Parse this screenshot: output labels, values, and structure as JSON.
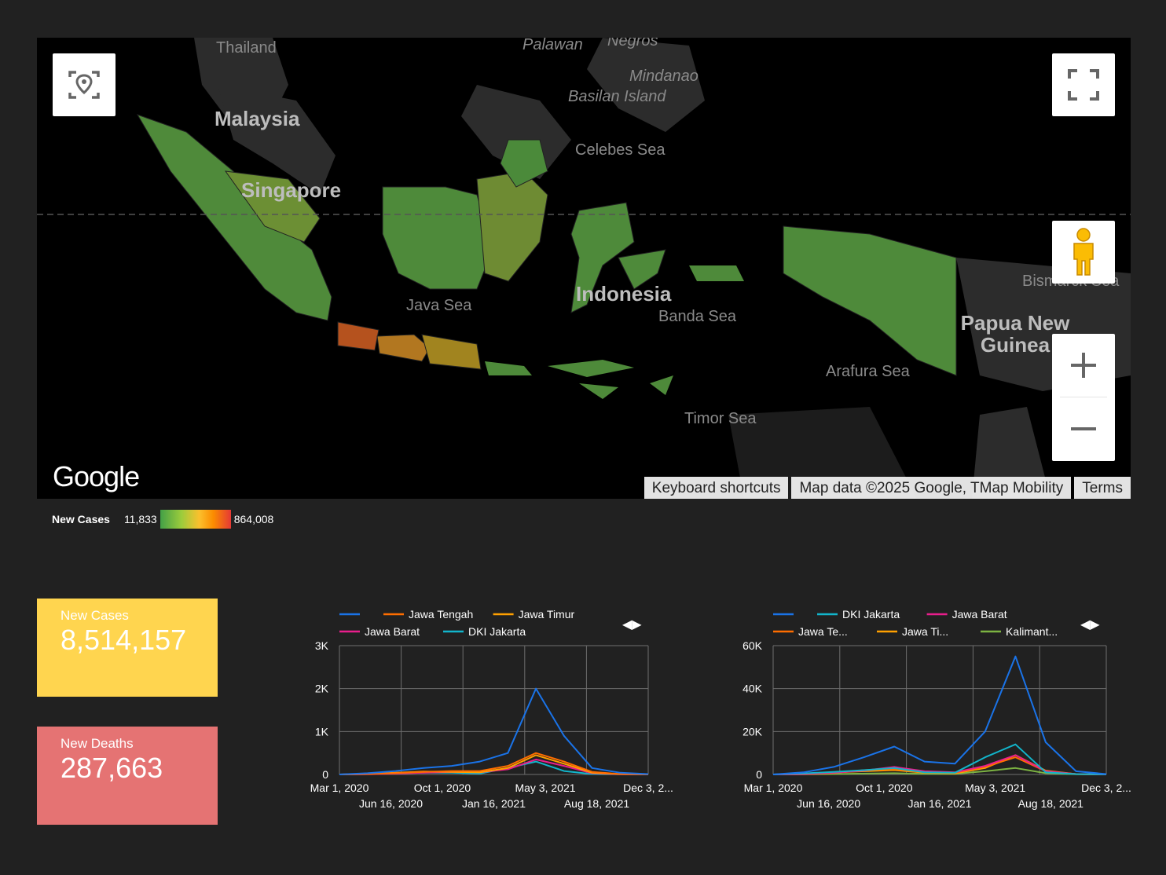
{
  "map": {
    "labels": {
      "thailand": "Thailand",
      "palawan": "Palawan",
      "negros": "Negros",
      "mindanao": "Mindanao",
      "basilan": "Basilan Island",
      "malaysia": "Malaysia",
      "celebes_sea": "Celebes Sea",
      "singapore": "Singapore",
      "bismarck_sea": "Bismarck Sea",
      "java_sea": "Java Sea",
      "indonesia": "Indonesia",
      "banda_sea": "Banda Sea",
      "papua": "Papua New Guinea",
      "arafura_sea": "Arafura Sea",
      "timor_sea": "Timor Sea"
    },
    "logo": "Google",
    "attribution": {
      "shortcuts": "Keyboard shortcuts",
      "map_data": "Map data ©2025 Google, TMap Mobility",
      "terms": "Terms"
    },
    "icons": {
      "locate": "location-focus-icon",
      "fullscreen": "fullscreen-icon",
      "pegman": "street-view-pegman-icon",
      "zoom_in": "plus-icon",
      "zoom_out": "minus-icon"
    }
  },
  "legend": {
    "title": "New Cases",
    "min": "11,833",
    "max": "864,008",
    "colors": [
      "#43a047",
      "#9ccc3c",
      "#fbc02d",
      "#fb8c00",
      "#e53935"
    ]
  },
  "scorecards": {
    "cases": {
      "label": "New Cases",
      "value": "8,514,157",
      "color": "#ffd54f"
    },
    "deaths": {
      "label": "New Deaths",
      "value": "287,663",
      "color": "#e57373"
    }
  },
  "chart_data": [
    {
      "type": "line",
      "legend_rows": [
        [
          {
            "name": "",
            "color": "#1a73e8"
          },
          {
            "name": "Jawa Tengah",
            "color": "#ff6d00"
          },
          {
            "name": "Jawa Timur",
            "color": "#ffa000"
          }
        ],
        [
          {
            "name": "Jawa Barat",
            "color": "#e91e8c"
          },
          {
            "name": "DKI Jakarta",
            "color": "#12b5cb"
          }
        ]
      ],
      "ylim": [
        0,
        3000
      ],
      "yticks": [
        "0",
        "1K",
        "2K",
        "3K"
      ],
      "xticks_row1": [
        "Mar 1, 2020",
        "Oct 1, 2020",
        "May 3, 2021",
        "Dec 3, 2..."
      ],
      "xticks_row2": [
        "Jun 16, 2020",
        "Jan 16, 2021",
        "Aug 18, 2021"
      ],
      "x": [
        "2020-03",
        "2020-06",
        "2020-09",
        "2020-12",
        "2021-03",
        "2021-05",
        "2021-06",
        "2021-07",
        "2021-08",
        "2021-09",
        "2021-10",
        "2021-12"
      ],
      "series": [
        {
          "name": "",
          "color": "#1a73e8",
          "values": [
            0,
            30,
            80,
            150,
            200,
            300,
            500,
            2000,
            900,
            150,
            40,
            10
          ]
        },
        {
          "name": "Jawa Tengah",
          "color": "#ff6d00",
          "values": [
            0,
            10,
            30,
            60,
            80,
            80,
            200,
            500,
            300,
            60,
            10,
            5
          ]
        },
        {
          "name": "Jawa Timur",
          "color": "#ffa000",
          "values": [
            0,
            15,
            40,
            70,
            60,
            50,
            150,
            450,
            250,
            40,
            10,
            5
          ]
        },
        {
          "name": "Jawa Barat",
          "color": "#e91e8c",
          "values": [
            0,
            5,
            20,
            40,
            60,
            50,
            120,
            350,
            200,
            30,
            5,
            2
          ]
        },
        {
          "name": "DKI Jakarta",
          "color": "#12b5cb",
          "values": [
            0,
            10,
            30,
            40,
            40,
            20,
            150,
            300,
            80,
            10,
            3,
            1
          ]
        }
      ]
    },
    {
      "type": "line",
      "legend_rows": [
        [
          {
            "name": "",
            "color": "#1a73e8"
          },
          {
            "name": "DKI Jakarta",
            "color": "#12b5cb"
          },
          {
            "name": "Jawa Barat",
            "color": "#e91e8c"
          }
        ],
        [
          {
            "name": "Jawa Te...",
            "color": "#ff6d00"
          },
          {
            "name": "Jawa Ti...",
            "color": "#ffa000"
          },
          {
            "name": "Kalimant...",
            "color": "#7cb342"
          }
        ]
      ],
      "ylim": [
        0,
        60000
      ],
      "yticks": [
        "0",
        "20K",
        "40K",
        "60K"
      ],
      "xticks_row1": [
        "Mar 1, 2020",
        "Oct 1, 2020",
        "May 3, 2021",
        "Dec 3, 2..."
      ],
      "xticks_row2": [
        "Jun 16, 2020",
        "Jan 16, 2021",
        "Aug 18, 2021"
      ],
      "x": [
        "2020-03",
        "2020-06",
        "2020-09",
        "2020-12",
        "2021-01",
        "2021-03",
        "2021-05",
        "2021-06",
        "2021-07",
        "2021-08",
        "2021-09",
        "2021-12"
      ],
      "series": [
        {
          "name": "",
          "color": "#1a73e8",
          "values": [
            0,
            1000,
            3500,
            8000,
            13000,
            6000,
            5000,
            20000,
            55000,
            15000,
            1500,
            200
          ]
        },
        {
          "name": "DKI Jakarta",
          "color": "#12b5cb",
          "values": [
            0,
            500,
            1200,
            2000,
            3000,
            1000,
            800,
            8000,
            14000,
            1000,
            200,
            50
          ]
        },
        {
          "name": "Jawa Barat",
          "color": "#e91e8c",
          "values": [
            0,
            200,
            800,
            1800,
            3500,
            1500,
            1000,
            4000,
            9000,
            1500,
            200,
            50
          ]
        },
        {
          "name": "Jawa Te...",
          "color": "#ff6d00",
          "values": [
            0,
            100,
            700,
            2000,
            2500,
            1000,
            800,
            3500,
            8000,
            1500,
            200,
            50
          ]
        },
        {
          "name": "Jawa Ti...",
          "color": "#ffa000",
          "values": [
            0,
            200,
            900,
            1500,
            2000,
            800,
            500,
            3000,
            9000,
            1800,
            200,
            50
          ]
        },
        {
          "name": "Kalimant...",
          "color": "#7cb342",
          "values": [
            0,
            50,
            200,
            400,
            600,
            300,
            300,
            1500,
            3000,
            600,
            100,
            20
          ]
        }
      ]
    }
  ]
}
